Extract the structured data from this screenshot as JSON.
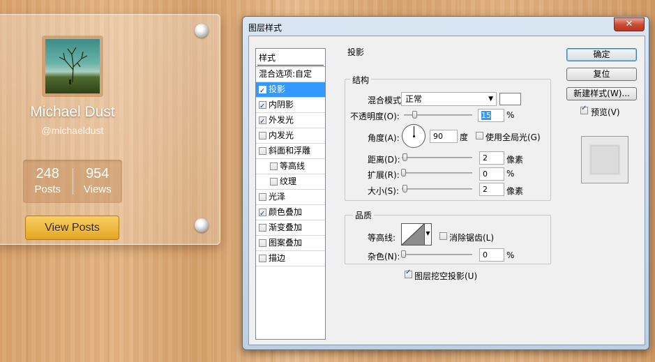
{
  "card": {
    "name": "Michael Dust",
    "handle": "@michaeldust",
    "posts_count": "248",
    "posts_label": "Posts",
    "views_count": "954",
    "views_label": "Views",
    "button": "View Posts"
  },
  "dialog": {
    "title": "图层样式",
    "close": "✕",
    "list_header": "样式",
    "blend_options": "混合选项:自定",
    "items": [
      {
        "label": "投影",
        "checked": true,
        "selected": true
      },
      {
        "label": "内阴影",
        "checked": true
      },
      {
        "label": "外发光",
        "checked": true
      },
      {
        "label": "内发光",
        "checked": false
      },
      {
        "label": "斜面和浮雕",
        "checked": false
      },
      {
        "label": "等高线",
        "checked": false
      },
      {
        "label": "纹理",
        "checked": false
      },
      {
        "label": "光泽",
        "checked": false
      },
      {
        "label": "颜色叠加",
        "checked": true
      },
      {
        "label": "渐变叠加",
        "checked": false
      },
      {
        "label": "图案叠加",
        "checked": false
      },
      {
        "label": "描边",
        "checked": false
      }
    ],
    "section_title": "投影",
    "structure": {
      "title": "结构",
      "blend_mode_label": "混合模式:",
      "blend_mode_value": "正常",
      "opacity_label": "不透明度(O):",
      "opacity_value": "15",
      "opacity_unit": "%",
      "opacity_fraction": 0.15,
      "angle_label": "角度(A):",
      "angle_value": "90",
      "angle_unit": "度",
      "global_light_label": "使用全局光(G)",
      "distance_label": "距离(D):",
      "distance_value": "2",
      "distance_unit": "像素",
      "spread_label": "扩展(R):",
      "spread_value": "0",
      "spread_unit": "%",
      "size_label": "大小(S):",
      "size_value": "2",
      "size_unit": "像素"
    },
    "quality": {
      "title": "品质",
      "contour_label": "等高线:",
      "antialias_label": "消除锯齿(L)",
      "noise_label": "杂色(N):",
      "noise_value": "0",
      "noise_unit": "%"
    },
    "knockout_label": "图层挖空投影(U)",
    "buttons": {
      "ok": "确定",
      "reset": "复位",
      "new_style": "新建样式(W)...",
      "preview": "预览(V)"
    }
  }
}
